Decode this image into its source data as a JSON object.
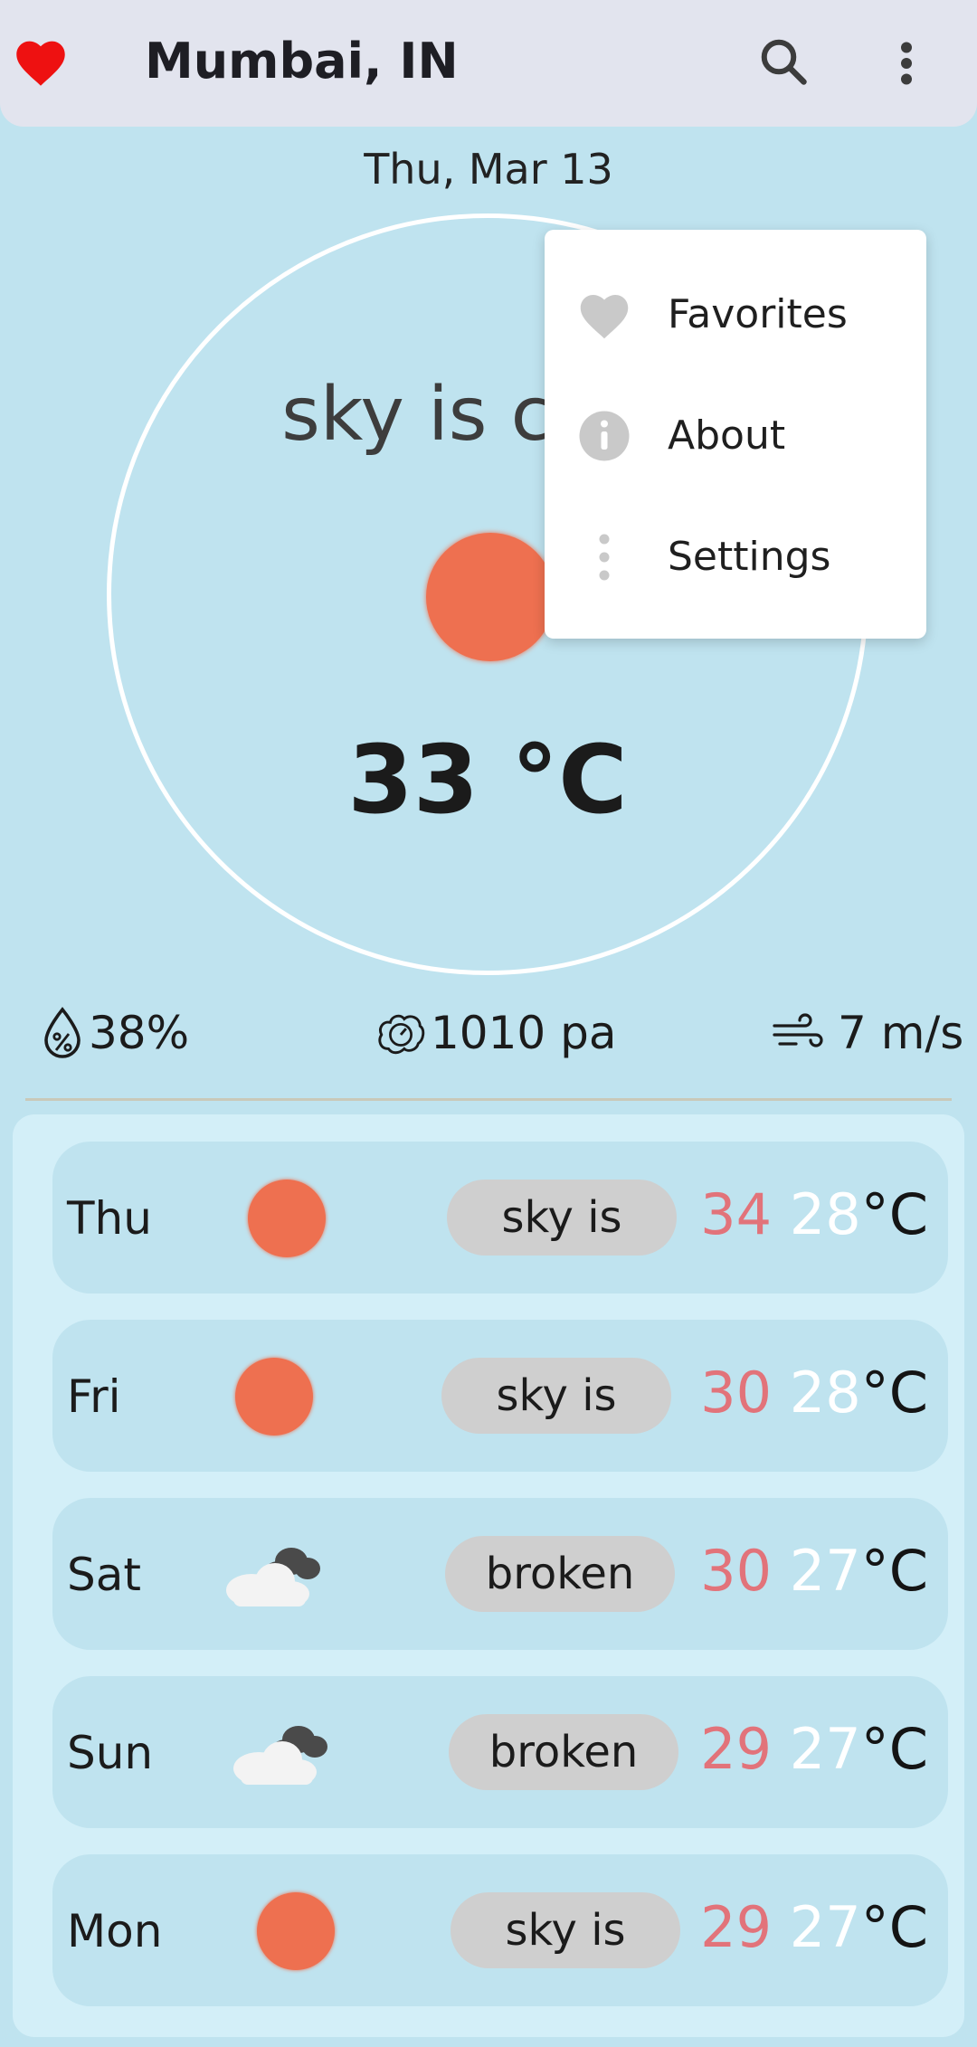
{
  "header": {
    "city": "Mumbai, IN",
    "icons": {
      "favorite": "heart-icon",
      "search": "search-icon",
      "more": "more-vert-icon"
    },
    "colors": {
      "heart": "#ee1111",
      "bar": "#e2e4ee"
    }
  },
  "current": {
    "date": "Thu, Mar 13",
    "description": "sky is clear",
    "temperature": "33 °C",
    "condition_icon": "sun-icon",
    "humidity": "38%",
    "pressure": "1010 pa",
    "wind": "7 m/s",
    "stat_icons": {
      "humidity": "humidity-drop-icon",
      "pressure": "pressure-gauge-icon",
      "wind": "wind-icon"
    }
  },
  "menu": {
    "items": [
      {
        "label": "Favorites",
        "icon": "heart-icon"
      },
      {
        "label": "About",
        "icon": "info-icon"
      },
      {
        "label": "Settings",
        "icon": "more-vert-icon"
      }
    ]
  },
  "forecast": [
    {
      "day": "Thu",
      "icon": "sun-icon",
      "desc": "sky is",
      "high": "34",
      "low": "28",
      "unit": "°C"
    },
    {
      "day": "Fri",
      "icon": "sun-icon",
      "desc": "sky is",
      "high": "30",
      "low": "28",
      "unit": "°C"
    },
    {
      "day": "Sat",
      "icon": "broken-clouds-icon",
      "desc": "broken",
      "high": "30",
      "low": "27",
      "unit": "°C"
    },
    {
      "day": "Sun",
      "icon": "broken-clouds-icon",
      "desc": "broken",
      "high": "29",
      "low": "27",
      "unit": "°C"
    },
    {
      "day": "Mon",
      "icon": "sun-icon",
      "desc": "sky is",
      "high": "29",
      "low": "27",
      "unit": "°C"
    }
  ],
  "colors": {
    "background": "#bfe3ef",
    "sun": "#ee7050",
    "high_temp": "#e2737a",
    "low_temp": "#ffffff"
  }
}
